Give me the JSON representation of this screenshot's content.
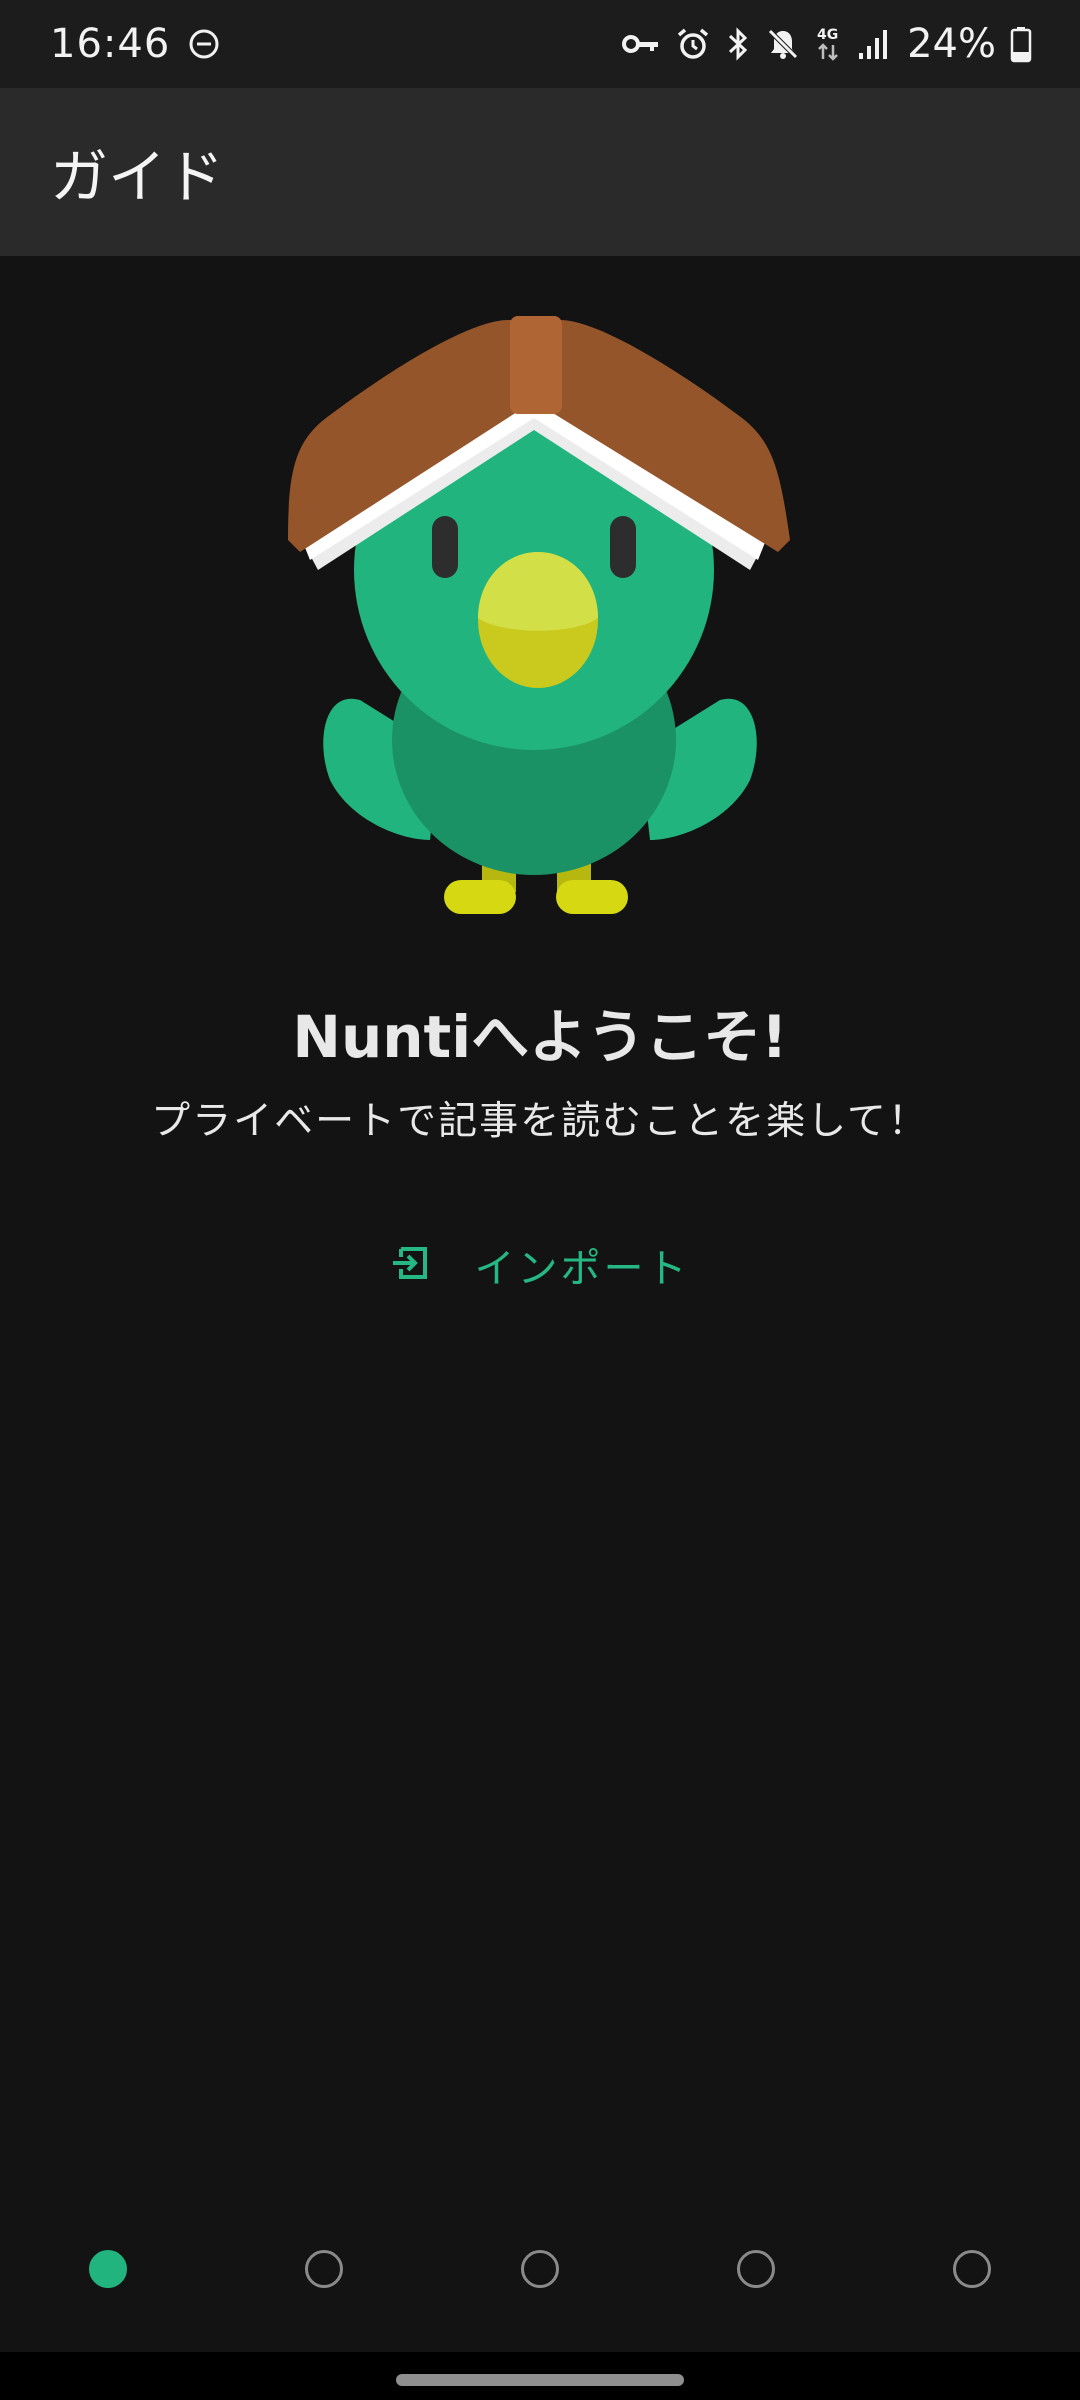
{
  "status_bar": {
    "time": "16:46",
    "battery_percent": "24%",
    "network_label": "4G",
    "icons": [
      "dnd-icon",
      "vpn-key-icon",
      "alarm-icon",
      "bluetooth-icon",
      "mute-icon",
      "network-4g-icon",
      "signal-icon",
      "battery-icon"
    ]
  },
  "app_bar": {
    "title": "ガイド"
  },
  "welcome": {
    "title": "Nuntiへようこそ!",
    "subtitle": "プライベートで記事を読むことを楽して！"
  },
  "import_button": {
    "label": "インポート",
    "icon": "import-icon"
  },
  "pager": {
    "total_pages": 5,
    "current_page": 1
  },
  "colors": {
    "accent": "#22b47f",
    "background": "#131313",
    "app_bar": "#2a2a2a"
  }
}
